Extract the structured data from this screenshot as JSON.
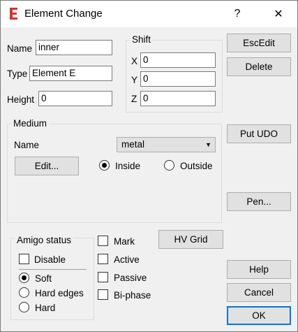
{
  "window": {
    "title": "Element Change",
    "help_glyph": "?",
    "close_glyph": "✕",
    "app_icon_letter": "E"
  },
  "fields": {
    "name_label": "Name",
    "name_value": "inner",
    "type_label": "Type",
    "type_value": "Element E",
    "height_label": "Height",
    "height_value": "0"
  },
  "shift": {
    "title": "Shift",
    "x_label": "X",
    "x_value": "0",
    "y_label": "Y",
    "y_value": "0",
    "z_label": "Z",
    "z_value": "0"
  },
  "medium": {
    "title": "Medium",
    "name_label": "Name",
    "selected": "metal",
    "edit_label": "Edit...",
    "inside_label": "Inside",
    "outside_label": "Outside",
    "inside_checked": true
  },
  "amigo": {
    "title": "Amigo status",
    "disable_label": "Disable",
    "soft_label": "Soft",
    "hard_edges_label": "Hard edges",
    "hard_label": "Hard",
    "selected": "Soft"
  },
  "flags": {
    "mark_label": "Mark",
    "active_label": "Active",
    "passive_label": "Passive",
    "biphase_label": "Bi-phase"
  },
  "buttons": {
    "escedit": "EscEdit",
    "delete": "Delete",
    "put_udo": "Put UDO",
    "pen": "Pen...",
    "hv_grid": "HV Grid",
    "help": "Help",
    "cancel": "Cancel",
    "ok": "OK"
  },
  "colors": {
    "accent": "#0078d7",
    "app_icon": "#d9302b"
  }
}
